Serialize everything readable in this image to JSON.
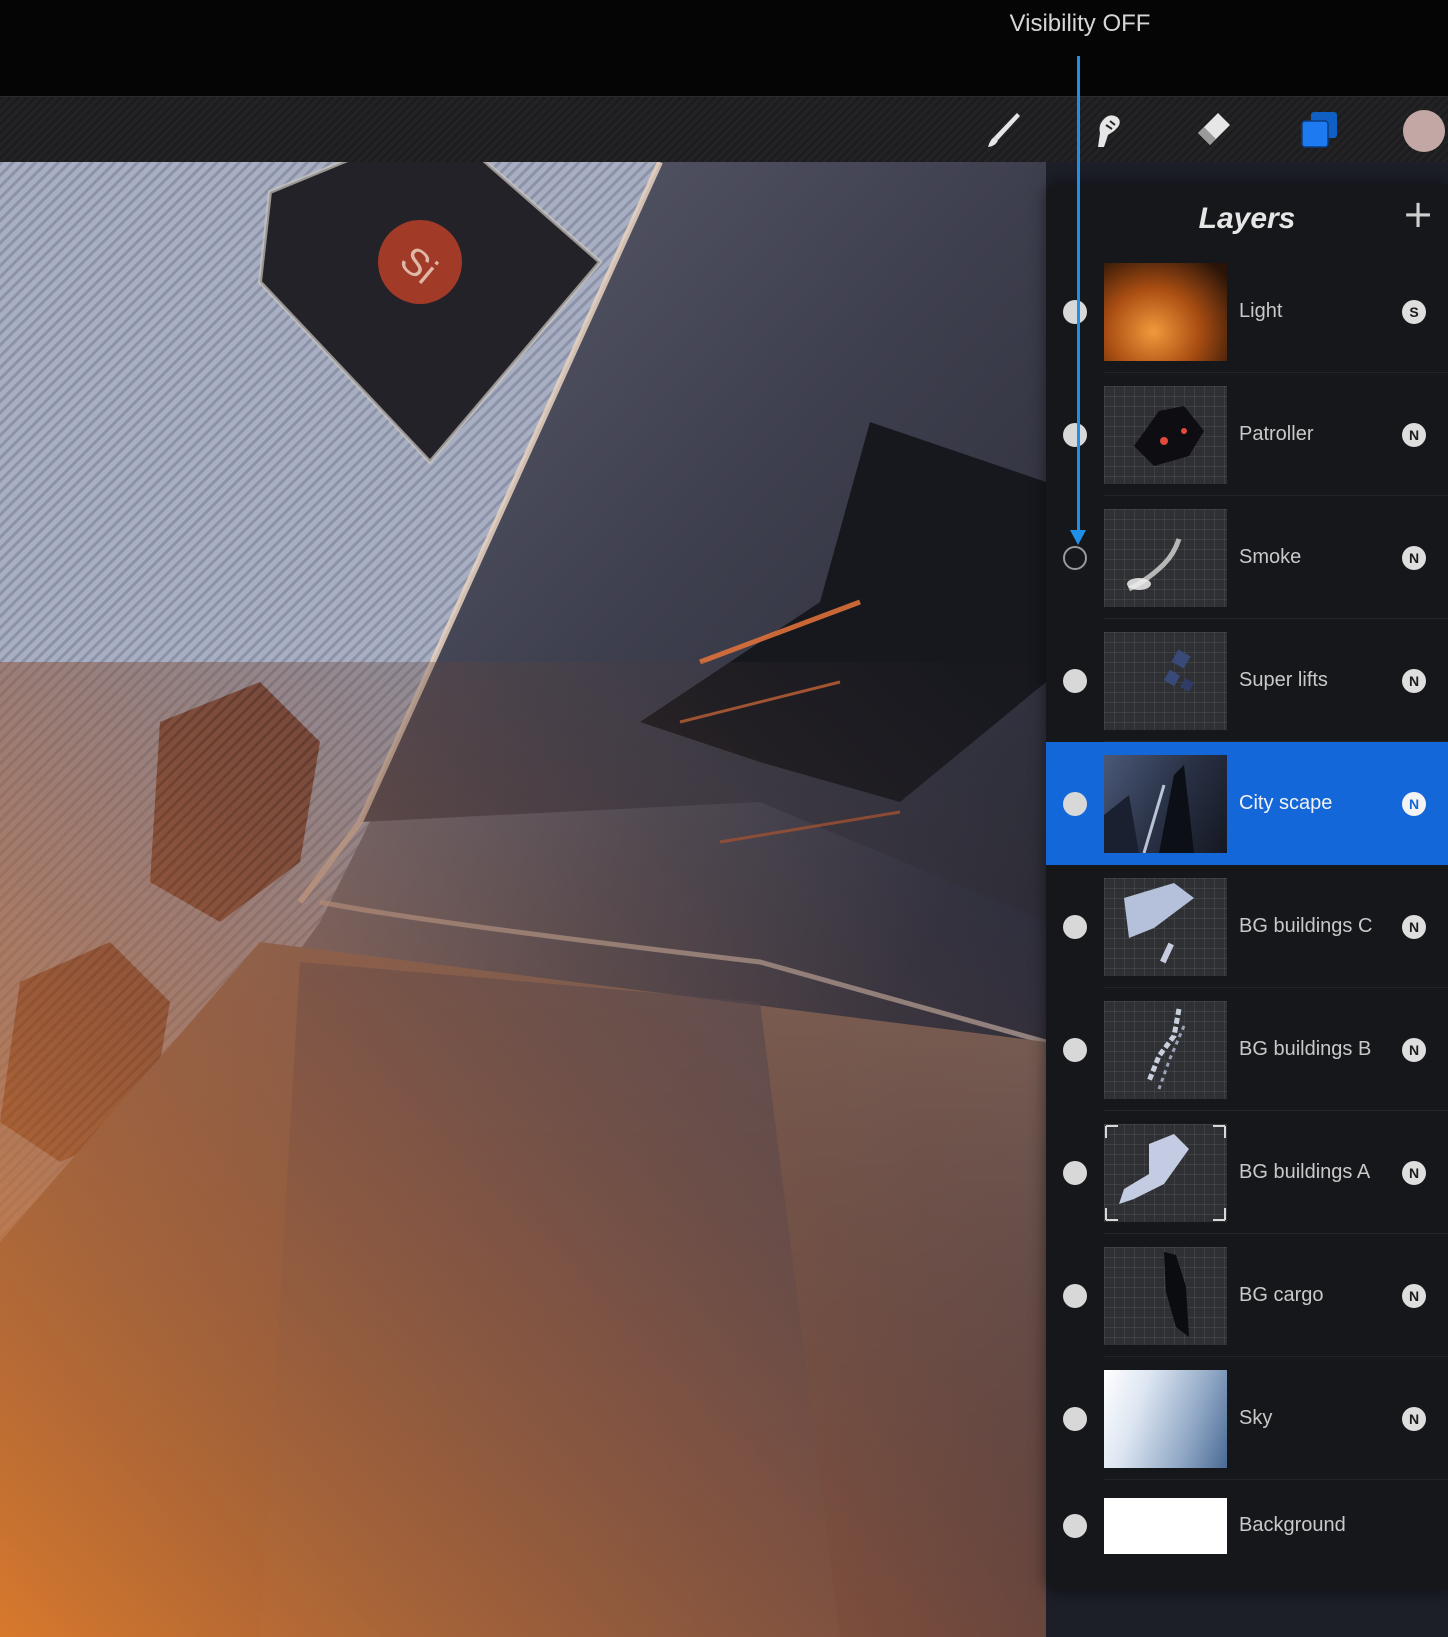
{
  "annotation": {
    "label": "Visibility OFF",
    "arrow_color": "#1f8fe8"
  },
  "toolbar": {
    "tools": [
      {
        "name": "brush",
        "icon": "brush-icon"
      },
      {
        "name": "smudge",
        "icon": "smudge-icon"
      },
      {
        "name": "eraser",
        "icon": "eraser-icon"
      },
      {
        "name": "layers",
        "icon": "layers-icon",
        "active": true
      }
    ],
    "color": "#c2a7a4"
  },
  "layers_panel": {
    "title": "Layers",
    "add_icon": "plus-icon",
    "layers": [
      {
        "name": "Light",
        "visible": true,
        "blend": "S",
        "selected": false
      },
      {
        "name": "Patroller",
        "visible": true,
        "blend": "N",
        "selected": false
      },
      {
        "name": "Smoke",
        "visible": false,
        "blend": "N",
        "selected": false
      },
      {
        "name": "Super lifts",
        "visible": true,
        "blend": "N",
        "selected": false
      },
      {
        "name": "City scape",
        "visible": true,
        "blend": "N",
        "selected": true
      },
      {
        "name": "BG buildings C",
        "visible": true,
        "blend": "N",
        "selected": false
      },
      {
        "name": "BG buildings B",
        "visible": true,
        "blend": "N",
        "selected": false
      },
      {
        "name": "BG buildings A",
        "visible": true,
        "blend": "N",
        "selected": false
      },
      {
        "name": "BG cargo",
        "visible": true,
        "blend": "N",
        "selected": false
      },
      {
        "name": "Sky",
        "visible": true,
        "blend": "N",
        "selected": false
      },
      {
        "name": "Background",
        "visible": true,
        "blend": "",
        "selected": false
      }
    ],
    "accent": "#1467d8"
  },
  "canvas": {
    "sign_text": "Si"
  }
}
